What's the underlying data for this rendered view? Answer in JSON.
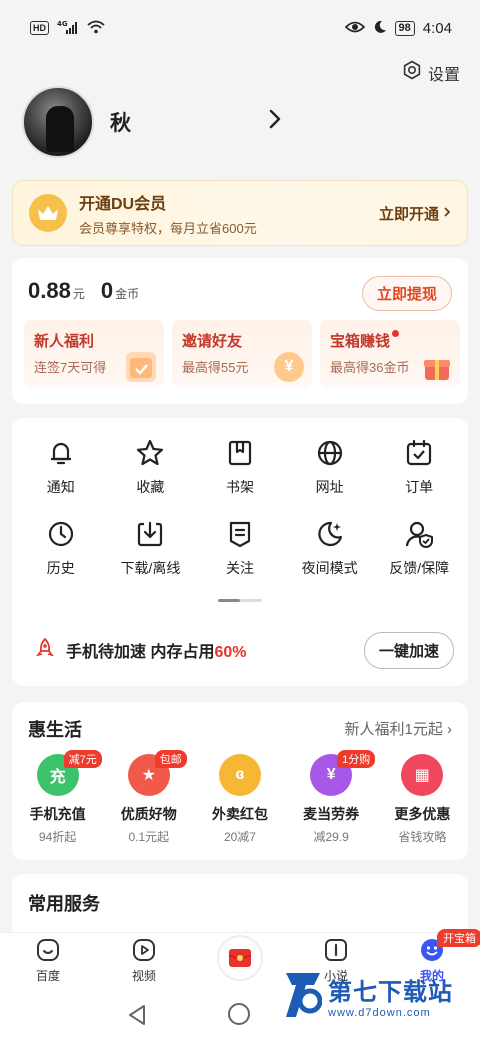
{
  "status_bar": {
    "hd": "HD",
    "network": "4G",
    "battery": "98",
    "time": "4:04"
  },
  "settings": {
    "label": "设置"
  },
  "profile": {
    "name": "秋"
  },
  "vip": {
    "title": "开通DU会员",
    "subtitle": "会员尊享特权，每月立省600元",
    "button": "立即开通"
  },
  "wallet": {
    "cash_value": "0.88",
    "cash_unit": "元",
    "coin_value": "0",
    "coin_unit": "金币",
    "withdraw_button": "立即提现",
    "tiles": [
      {
        "title": "新人福利",
        "sub": "连签7天可得"
      },
      {
        "title": "邀请好友",
        "sub": "最高得55元"
      },
      {
        "title": "宝箱赚钱",
        "sub": "最高得36金币"
      }
    ]
  },
  "menu": {
    "items": [
      {
        "label": "通知",
        "icon": "bell-icon"
      },
      {
        "label": "收藏",
        "icon": "star-icon"
      },
      {
        "label": "书架",
        "icon": "bookmark-icon"
      },
      {
        "label": "网址",
        "icon": "globe-icon"
      },
      {
        "label": "订单",
        "icon": "calendar-check-icon"
      },
      {
        "label": "历史",
        "icon": "clock-icon"
      },
      {
        "label": "下载/离线",
        "icon": "download-icon"
      },
      {
        "label": "关注",
        "icon": "follow-icon"
      },
      {
        "label": "夜间模式",
        "icon": "moon-icon"
      },
      {
        "label": "反馈/保障",
        "icon": "user-shield-icon"
      }
    ],
    "speed": {
      "text": "手机待加速 内存占用",
      "percent": "60%",
      "button": "一键加速"
    }
  },
  "life": {
    "title": "惠生活",
    "more": "新人福利1元起",
    "items": [
      {
        "name": "手机充值",
        "sub": "94折起",
        "badge": "减7元",
        "color": "#3cc26a",
        "glyph": "充"
      },
      {
        "name": "优质好物",
        "sub": "0.1元起",
        "badge": "包邮",
        "color": "#f05a4a",
        "glyph": "★"
      },
      {
        "name": "外卖红包",
        "sub": "20减7",
        "badge": "",
        "color": "#f6b735",
        "glyph": "ɞ"
      },
      {
        "name": "麦当劳券",
        "sub": "减29.9",
        "badge": "1分购",
        "color": "#a758e6",
        "glyph": "¥"
      },
      {
        "name": "更多优惠",
        "sub": "省钱攻略",
        "badge": "",
        "color": "#f0475e",
        "glyph": "▦"
      }
    ]
  },
  "services": {
    "title": "常用服务"
  },
  "tabbar": {
    "tabs": [
      {
        "label": "百度"
      },
      {
        "label": "视频"
      },
      {
        "label": ""
      },
      {
        "label": "小说"
      },
      {
        "label": "我的"
      }
    ],
    "badge": "开宝箱"
  },
  "watermark": {
    "main": "第七下载站",
    "sub": "www.d7down.com"
  },
  "colors": {
    "accent_red": "#e8322e",
    "accent_blue": "#3a56f5",
    "vip_brown": "#6b3f10"
  }
}
